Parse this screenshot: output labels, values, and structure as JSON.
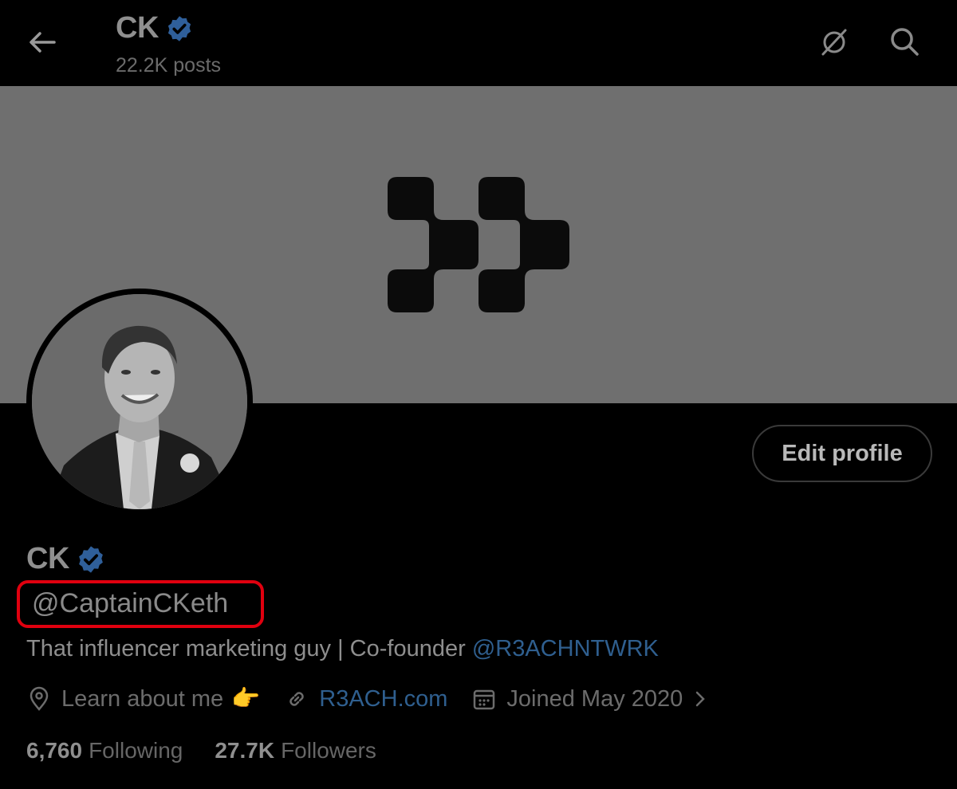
{
  "header": {
    "name": "CK",
    "posts": "22.2K posts"
  },
  "profile": {
    "name": "CK",
    "handle": "@CaptainCKeth",
    "bio_text": "That influencer marketing guy | Co-founder ",
    "bio_mention": "@R3ACHNTWRK",
    "edit_button": "Edit profile",
    "location": "Learn about me",
    "location_emoji": "👉",
    "website": "R3ACH.com",
    "joined": "Joined May 2020",
    "following_count": "6,760",
    "following_label": "Following",
    "followers_count": "27.7K",
    "followers_label": "Followers"
  },
  "colors": {
    "verified": "#2f5f9a",
    "link": "#2f5f8f",
    "highlight_box": "#e0000f",
    "banner": "#6f6f6f"
  },
  "icons": [
    "back-arrow-icon",
    "verified-badge-icon",
    "grok-icon",
    "search-icon",
    "location-pin-icon",
    "link-icon",
    "calendar-icon",
    "chevron-right-icon"
  ]
}
